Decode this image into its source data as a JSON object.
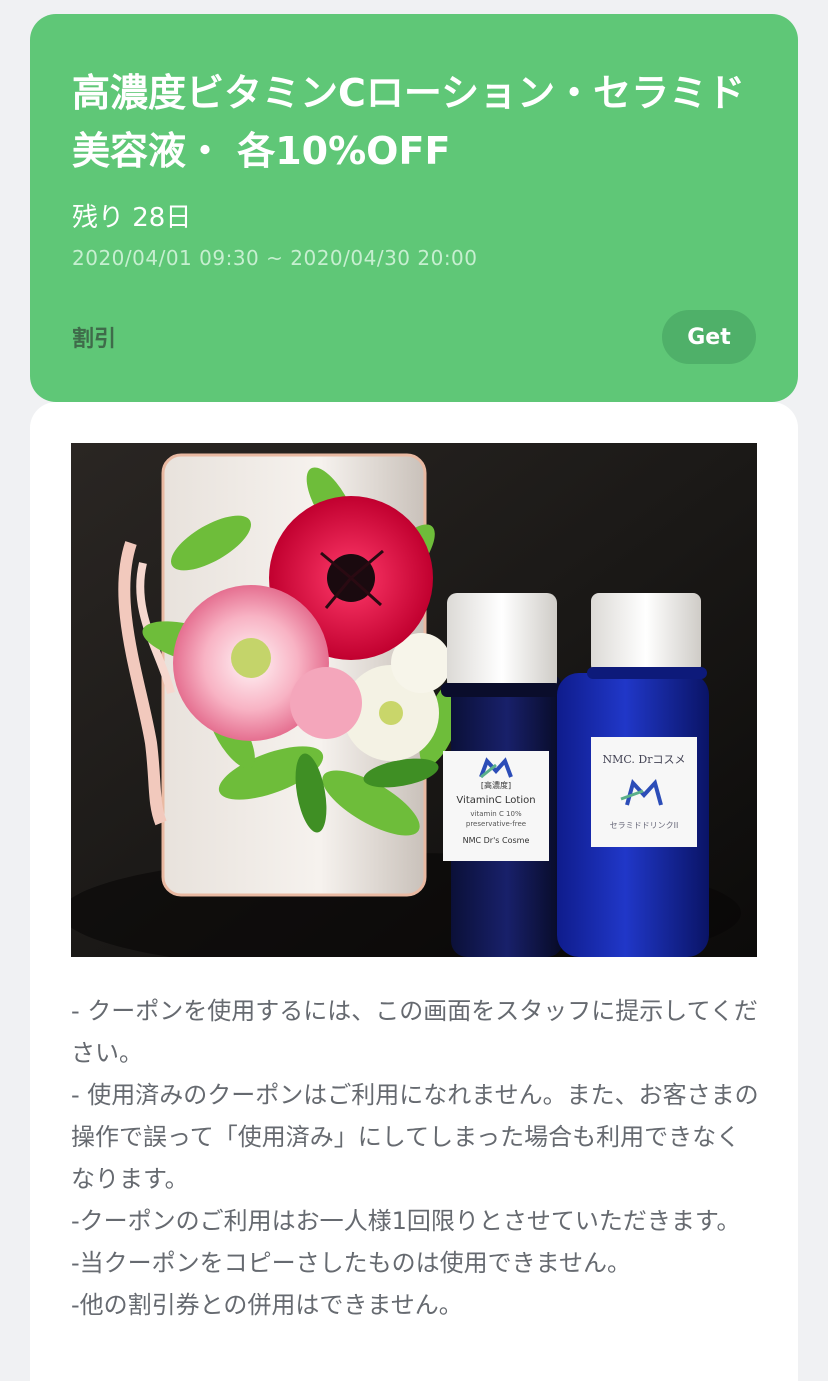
{
  "coupon": {
    "title": "高濃度ビタミンCローション・セラミド美容液・ 各10%OFF",
    "remaining": "残り 28日",
    "period": "2020/04/01 09:30 ~ 2020/04/30 20:00",
    "category": "割引",
    "get_label": "Get",
    "accent_color": "#5fc777"
  },
  "photo": {
    "bottle_left_label": {
      "line1": "[高濃度]",
      "line2": "VitaminC Lotion",
      "line3": "vitamin C 10%",
      "line4": "preservative-free",
      "line5": "NMC Dr's Cosme"
    },
    "bottle_right_label": {
      "line1": "NMC. Drコスメ",
      "line2": "セラミドドリンクII"
    }
  },
  "notes": [
    "- クーポンを使用するには、この画面をスタッフに提示してください。",
    "- 使用済みのクーポンはご利用になれません。また、お客さまの操作で誤って「使用済み」にしてしまった場合も利用できなくなります。",
    "-クーポンのご利用はお一人様1回限りとさせていただきます。",
    "-当クーポンをコピーさしたものは使用できません。",
    "-他の割引券との併用はできません。"
  ]
}
